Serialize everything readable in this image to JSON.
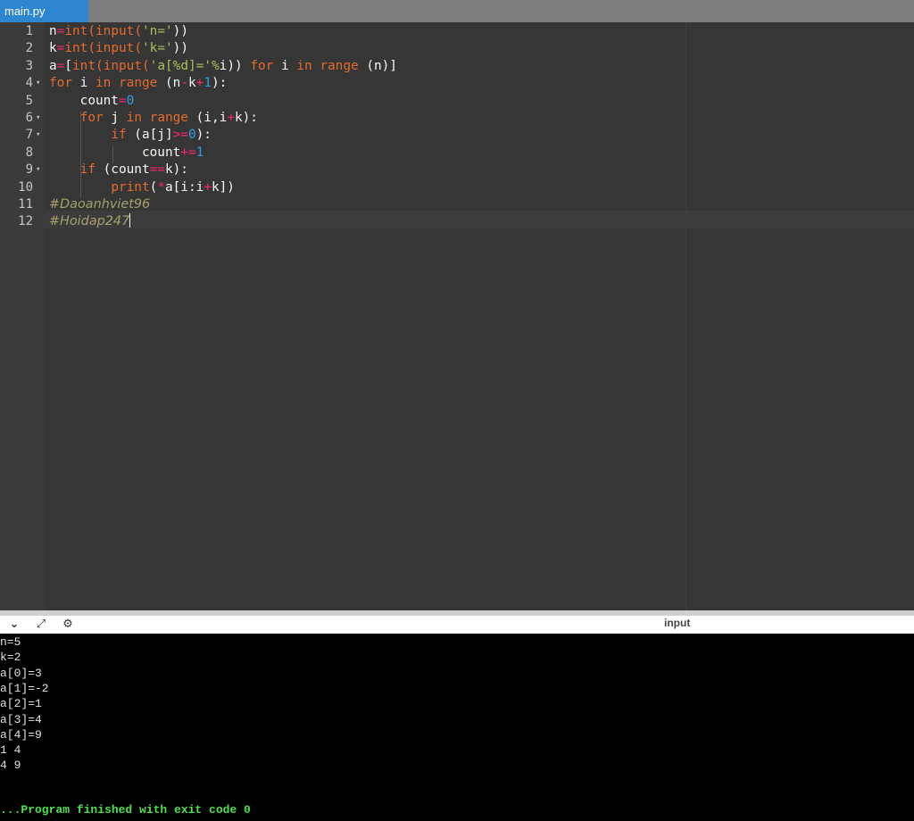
{
  "tab": {
    "filename": "main.py"
  },
  "editor": {
    "line_numbers": [
      "1",
      "2",
      "3",
      "4",
      "5",
      "6",
      "7",
      "8",
      "9",
      "10",
      "11",
      "12"
    ],
    "fold_marker": "▾",
    "cursor_line": "12",
    "lines": [
      [
        [
          "p",
          "n"
        ],
        [
          "o",
          "="
        ],
        [
          "f",
          "int"
        ],
        [
          "f",
          "("
        ],
        [
          "f",
          "input"
        ],
        [
          "f",
          "("
        ],
        [
          "s",
          "'n='"
        ],
        [
          "p",
          "))"
        ]
      ],
      [
        [
          "p",
          "k"
        ],
        [
          "o",
          "="
        ],
        [
          "f",
          "int"
        ],
        [
          "f",
          "("
        ],
        [
          "f",
          "input"
        ],
        [
          "f",
          "("
        ],
        [
          "s",
          "'k='"
        ],
        [
          "p",
          "))"
        ]
      ],
      [
        [
          "p",
          "a"
        ],
        [
          "o",
          "="
        ],
        [
          "p",
          "["
        ],
        [
          "f",
          "int"
        ],
        [
          "f",
          "("
        ],
        [
          "f",
          "input"
        ],
        [
          "f",
          "("
        ],
        [
          "s",
          "'a[%d]='"
        ],
        [
          "s",
          "%"
        ],
        [
          "p",
          "i)) "
        ],
        [
          "kw",
          "for"
        ],
        [
          "p",
          " i "
        ],
        [
          "kw",
          "in"
        ],
        [
          "p",
          " "
        ],
        [
          "f",
          "range"
        ],
        [
          "p",
          " (n)]"
        ]
      ],
      [
        [
          "kw",
          "for"
        ],
        [
          "p",
          " i "
        ],
        [
          "kw",
          "in"
        ],
        [
          "p",
          " "
        ],
        [
          "f",
          "range"
        ],
        [
          "p",
          " (n"
        ],
        [
          "o",
          "-"
        ],
        [
          "p",
          "k"
        ],
        [
          "o",
          "+"
        ],
        [
          "n",
          "1"
        ],
        [
          "p",
          "):"
        ]
      ],
      [
        [
          "p",
          "    count"
        ],
        [
          "o",
          "="
        ],
        [
          "n",
          "0"
        ]
      ],
      [
        [
          "p",
          "    "
        ],
        [
          "kw",
          "for"
        ],
        [
          "p",
          " j "
        ],
        [
          "kw",
          "in"
        ],
        [
          "p",
          " "
        ],
        [
          "f",
          "range"
        ],
        [
          "p",
          " (i,i"
        ],
        [
          "o",
          "+"
        ],
        [
          "p",
          "k):"
        ]
      ],
      [
        [
          "p",
          "        "
        ],
        [
          "kw",
          "if"
        ],
        [
          "p",
          " (a[j]"
        ],
        [
          "o",
          ">="
        ],
        [
          "n",
          "0"
        ],
        [
          "p",
          "):"
        ]
      ],
      [
        [
          "p",
          "            count"
        ],
        [
          "o",
          "+="
        ],
        [
          "n",
          "1"
        ]
      ],
      [
        [
          "p",
          "    "
        ],
        [
          "kw",
          "if"
        ],
        [
          "p",
          " (count"
        ],
        [
          "o",
          "=="
        ],
        [
          "p",
          "k):"
        ]
      ],
      [
        [
          "p",
          "        "
        ],
        [
          "f",
          "print"
        ],
        [
          "p",
          "("
        ],
        [
          "o",
          "*"
        ],
        [
          "p",
          "a[i:i"
        ],
        [
          "o",
          "+"
        ],
        [
          "p",
          "k])"
        ]
      ],
      [
        [
          "c",
          "#Daoanhviet96"
        ]
      ],
      [
        [
          "c",
          "#Hoidap247"
        ]
      ]
    ]
  },
  "console_toolbar": {
    "collapse_icon": "chevron-down-icon",
    "expand_icon": "expand-arrows-icon",
    "user_icon": "user-settings-icon",
    "input_label": "input"
  },
  "console": {
    "lines": [
      "n=5",
      "k=2",
      "a[0]=3",
      "a[1]=-2",
      "a[2]=1",
      "a[3]=4",
      "a[4]=9",
      "1 4",
      "4 9"
    ],
    "finish": "...Program finished with exit code 0"
  },
  "colors": {
    "tab_active": "#2e86d0",
    "editor_bg": "#363636",
    "console_bg": "#000000",
    "finish_text": "#4ce04c"
  }
}
